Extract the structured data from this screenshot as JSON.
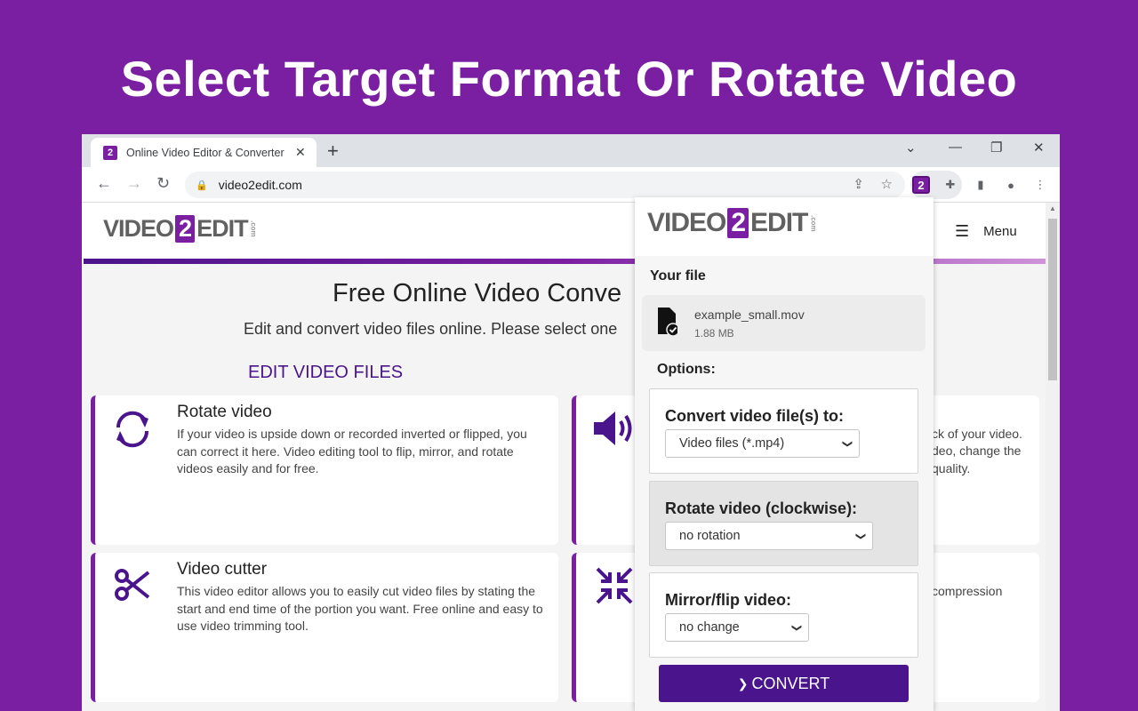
{
  "headline": "Select Target Format Or Rotate Video",
  "browser": {
    "tab_title": "Online Video Editor & Converter",
    "favicon_text": "2",
    "new_tab": "+",
    "url": "video2edit.com"
  },
  "site": {
    "logo": {
      "video": "VIDEO",
      "two": "2",
      "edit": "EDIT",
      "com": ".com"
    },
    "menu_label": "Menu",
    "hero_title": "Free Online Video Conve",
    "hero_sub": "Edit and convert video files online. Please select one",
    "section_title": "EDIT VIDEO FILES",
    "cards": [
      {
        "title": "Rotate video",
        "text": "If your video is upside down or recorded inverted or flipped, you can correct it here. Video editing tool to flip, mirror, and rotate videos easily and for free."
      },
      {
        "title": "Video cutter",
        "text": "This video editor allows you to easily cut video files by stating the start and end time of the portion you want. Free online and easy to use video trimming tool."
      }
    ],
    "right_card_fragments": {
      "audio": [
        "ck of your video.",
        "deo, change the",
        "quality."
      ],
      "compress": [
        "compression"
      ]
    }
  },
  "popup": {
    "your_file_label": "Your file",
    "file_name": "example_small.mov",
    "file_size": "1.88 MB",
    "options_label": "Options:",
    "convert_label": "Convert video file(s) to:",
    "convert_value": "Video files (*.mp4)",
    "rotate_label": "Rotate video (clockwise):",
    "rotate_value": "no rotation",
    "mirror_label": "Mirror/flip video:",
    "mirror_value": "no change",
    "convert_button": "CONVERT"
  }
}
